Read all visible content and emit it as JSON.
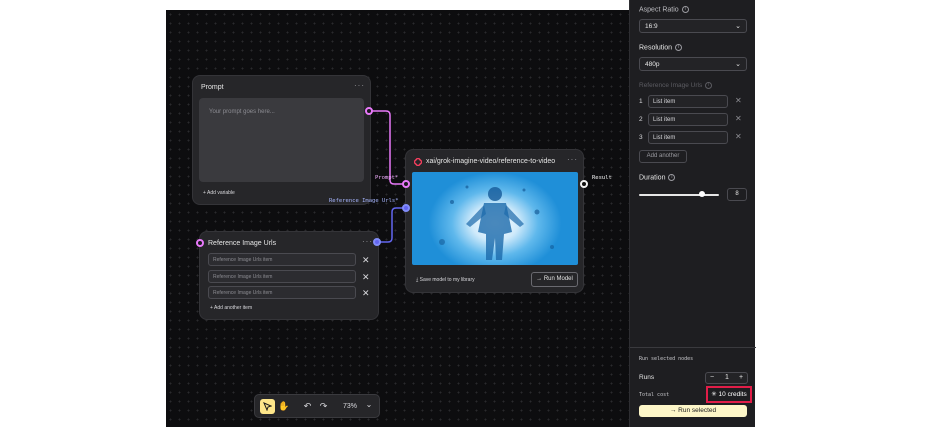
{
  "canvas": {
    "prompt_node": {
      "title": "Prompt",
      "menu": "···",
      "placeholder": "Your prompt goes here...",
      "add_variable": "+ Add variable"
    },
    "reference_node": {
      "title": "Reference Image Urls",
      "menu": "···",
      "items": [
        "Reference Image Urls item",
        "Reference Image Urls item",
        "Reference Image Urls item"
      ],
      "remove_icon": "✕",
      "add_item": "+ Add another item"
    },
    "model_node": {
      "title": "xai/grok-imagine-video/reference-to-video",
      "menu": "···",
      "save_label": "Save model to my library",
      "run_label": "→ Run Model"
    },
    "edge_labels": {
      "prompt": "Prompt*",
      "reference": "Reference Image Urls*",
      "result": "Result"
    },
    "toolbar": {
      "zoom": "73%",
      "select_icon": "cursor-icon",
      "hand_icon": "hand-icon",
      "undo_icon": "undo-icon",
      "redo_icon": "redo-icon",
      "chevron": "⌄"
    }
  },
  "panel": {
    "aspect_ratio": {
      "label": "Aspect Ratio",
      "value": "16:9"
    },
    "resolution": {
      "label": "Resolution",
      "value": "480p"
    },
    "reference_urls": {
      "label": "Reference Image Urls",
      "items": [
        {
          "num": "1",
          "value": "List item"
        },
        {
          "num": "2",
          "value": "List item"
        },
        {
          "num": "3",
          "value": "List item"
        }
      ],
      "add_label": "Add another"
    },
    "duration": {
      "label": "Duration",
      "value": "8",
      "slider_fraction": 0.79
    },
    "run_selected_nodes": "Run selected nodes",
    "runs": {
      "label": "Runs",
      "minus": "−",
      "value": "1",
      "plus": "+"
    },
    "total_cost": {
      "label": "Total cost",
      "value": "✳ 10 credits"
    },
    "run_button": "→ Run selected"
  },
  "colors": {
    "accent_pink": "#e879f9",
    "accent_blue": "#818cf8",
    "highlight": "#e11d48",
    "run_button_bg": "#fdf6c8"
  }
}
